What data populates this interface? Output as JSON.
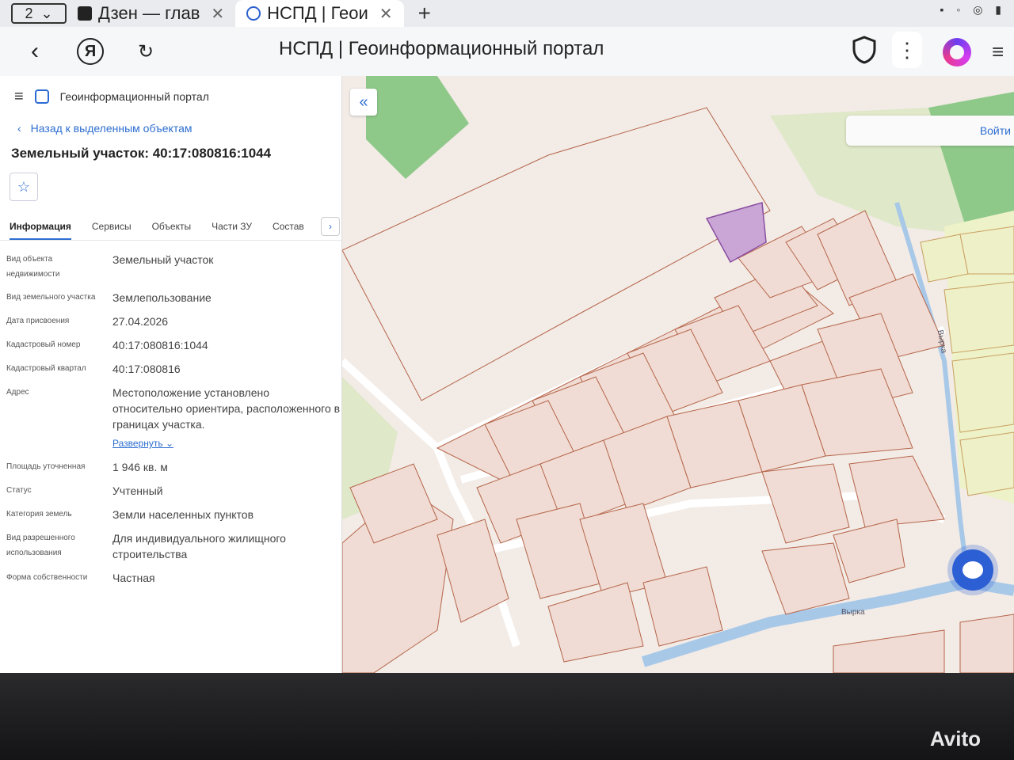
{
  "browser": {
    "tab_count": "2",
    "tabs": [
      {
        "title": "Дзен — глав",
        "active": false
      },
      {
        "title": "НСПД | Геои",
        "active": true
      }
    ],
    "page_title": "НСПД | Геоинформационный портал"
  },
  "panel": {
    "portal_name": "Геоинформационный портал",
    "back_link": "Назад к выделенным объектам",
    "object_title": "Земельный участок: 40:17:080816:1044",
    "tabs": [
      "Информация",
      "Сервисы",
      "Объекты",
      "Части ЗУ",
      "Состав"
    ],
    "attributes": [
      {
        "key": "Вид объекта недвижимости",
        "value": "Земельный участок"
      },
      {
        "key": "Вид земельного участка",
        "value": "Землепользование"
      },
      {
        "key": "Дата присвоения",
        "value": "27.04.2026"
      },
      {
        "key": "Кадастровый номер",
        "value": "40:17:080816:1044"
      },
      {
        "key": "Кадастровый квартал",
        "value": "40:17:080816"
      },
      {
        "key": "Адрес",
        "value": "Местоположение установлено относительно ориентира, расположенного в границах участка."
      },
      {
        "key": "Площадь уточненная",
        "value": "1 946 кв. м"
      },
      {
        "key": "Статус",
        "value": "Учтенный"
      },
      {
        "key": "Категория земель",
        "value": "Земли населенных пунктов"
      },
      {
        "key": "Вид разрешенного использования",
        "value": "Для индивидуального жилищного строительства"
      },
      {
        "key": "Форма собственности",
        "value": "Частная"
      }
    ],
    "expand_link": "Развернуть"
  },
  "map": {
    "login_label": "Войти",
    "river_labels": [
      "Вырка",
      "Вырка"
    ],
    "colors": {
      "parcel_fill": "#f0dcd4",
      "parcel_stroke": "#b5654a",
      "selected_parcel": "#c9a6d6",
      "forest": "#8fc98a",
      "meadow": "#dfe8c8",
      "river": "#a8c8e8"
    }
  },
  "watermark": "Avito"
}
